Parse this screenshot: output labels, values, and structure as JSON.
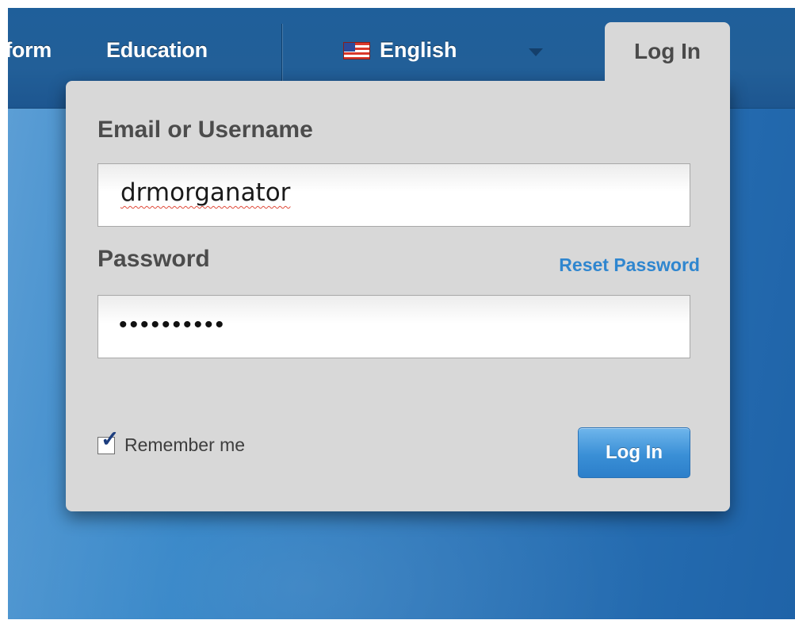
{
  "nav": {
    "platform_label": "Platform",
    "education_label": "Education",
    "language_label": "English",
    "login_tab_label": "Log In"
  },
  "login": {
    "email_label": "Email or Username",
    "email_value": "drmorganator",
    "password_label": "Password",
    "password_mask": "••••••••••",
    "reset_link": "Reset Password",
    "remember_label": "Remember me",
    "remember_checked": true,
    "submit_label": "Log In"
  },
  "colors": {
    "accent_blue": "#2f86cf",
    "nav_bg": "#225f98",
    "panel_bg": "#d8d8d8"
  },
  "icons": {
    "language": "us-flag-icon",
    "dropdown": "caret-down-icon",
    "checkbox": "checkmark-icon"
  }
}
